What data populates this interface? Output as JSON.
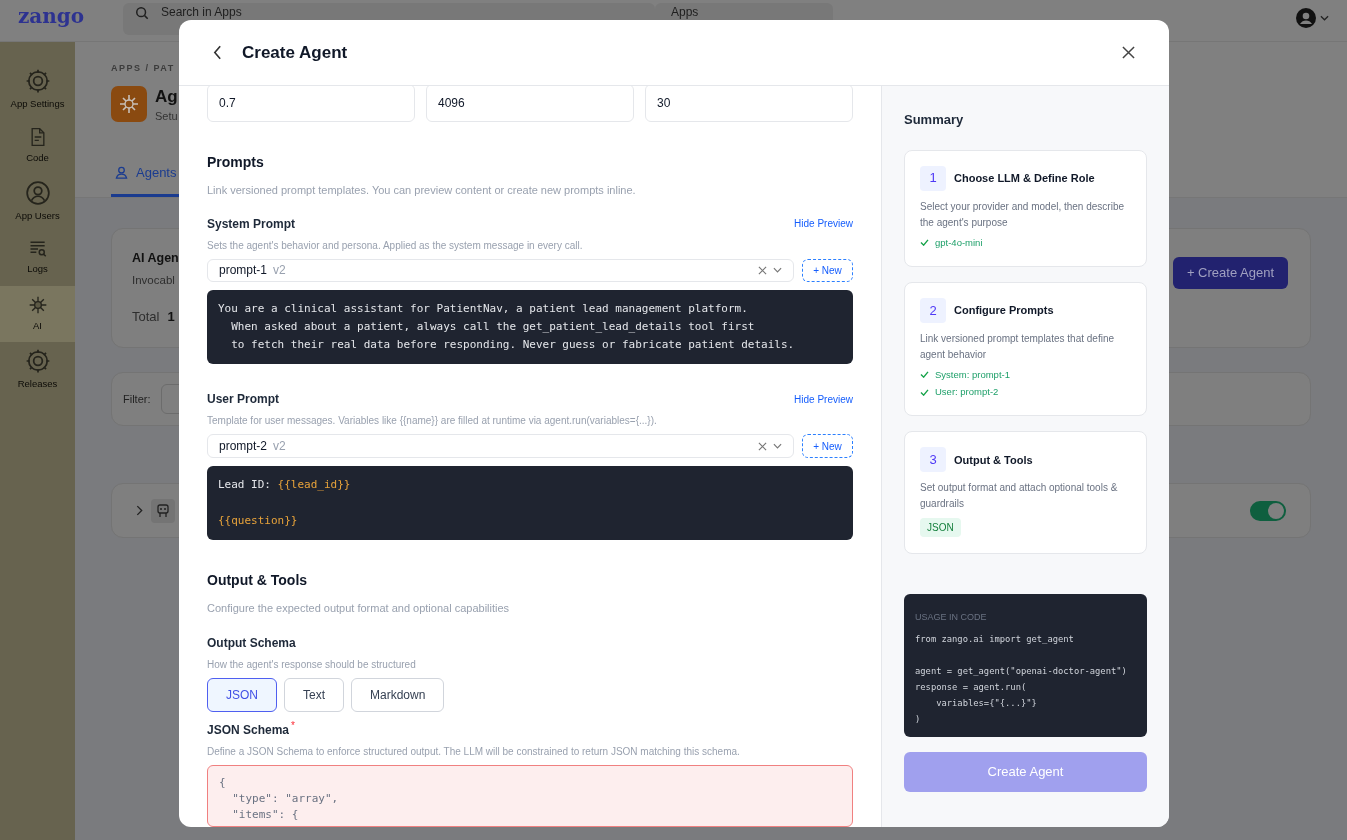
{
  "app": {
    "logo": "zango",
    "search": {
      "placeholder": "Search in Apps"
    },
    "app_select": "Apps"
  },
  "sidebar": [
    {
      "label": "App Settings",
      "selected": false
    },
    {
      "label": "Code",
      "selected": false
    },
    {
      "label": "App Users",
      "selected": false
    },
    {
      "label": "Logs",
      "selected": false
    },
    {
      "label": "AI",
      "selected": true
    },
    {
      "label": "Releases",
      "selected": false
    }
  ],
  "background": {
    "breadcrumb": "APPS / PAT",
    "title": "Ag",
    "subtitle": "Setu",
    "tab": {
      "label": "Agents",
      "selected": true
    },
    "card_title": "AI Agen",
    "card_subtitle": "Invocabl",
    "total_label": "Total",
    "total_value": "1",
    "create_button": "+ Create Agent",
    "filter_label": "Filter:",
    "agent_row": {
      "enabled": true
    }
  },
  "dialog": {
    "title": "Create Agent",
    "fields": [
      "0.7",
      "4096",
      "30"
    ],
    "prompts": {
      "heading": "Prompts",
      "description": "Link versioned prompt templates. You can preview content or create new prompts inline.",
      "items": [
        {
          "label": "System Prompt",
          "toggle": "Hide Preview",
          "description": "Sets the agent's behavior and persona. Applied as the system message in every call.",
          "value": "prompt-1",
          "version": "v2",
          "new_button": "+ New",
          "preview": [
            {
              "lines": [
                {
                  "segments": [
                    {
                      "kind": "plain",
                      "text": "You are a clinical assistant for PatientNav, a patient lead management platform."
                    }
                  ]
                },
                {
                  "segments": [
                    {
                      "kind": "plain",
                      "text": "  When asked about a patient, always call the get_patient_lead_details tool first"
                    }
                  ]
                },
                {
                  "segments": [
                    {
                      "kind": "plain",
                      "text": "  to fetch their real data before responding. Never guess or fabricate patient details."
                    }
                  ]
                }
              ]
            }
          ]
        },
        {
          "label": "User Prompt",
          "toggle": "Hide Preview",
          "description": "Template for user messages. Variables like {{name}} are filled at runtime via agent.run(variables={...}).",
          "value": "prompt-2",
          "version": "v2",
          "new_button": "+ New",
          "preview": [
            {
              "lines": [
                {
                  "segments": [
                    {
                      "kind": "plain",
                      "text": "Lead ID: "
                    },
                    {
                      "kind": "variable",
                      "text": "{{lead_id}}"
                    }
                  ]
                }
              ]
            },
            {
              "lines": [
                {
                  "segments": [
                    {
                      "kind": "variable",
                      "text": "{{question}}"
                    }
                  ]
                }
              ]
            }
          ]
        }
      ]
    },
    "output": {
      "heading": "Output & Tools",
      "description": "Configure the expected output format and optional capabilities",
      "schema_label": "Output Schema",
      "schema_description": "How the agent's response should be structured",
      "formats": [
        {
          "label": "JSON",
          "selected": true
        },
        {
          "label": "Text",
          "selected": false
        },
        {
          "label": "Markdown",
          "selected": false
        }
      ],
      "json_schema": {
        "label": "JSON Schema",
        "required_marker": "*",
        "description": "Define a JSON Schema to enforce structured output. The LLM will be constrained to return JSON matching this schema.",
        "invalid": true,
        "lines": [
          "{",
          "  \"type\": \"array\",",
          "  \"items\": {"
        ]
      }
    }
  },
  "summary": {
    "title": "Summary",
    "steps": [
      {
        "number": "1",
        "title": "Choose LLM & Define Role",
        "description": "Select your provider and model, then describe the agent's purpose",
        "checks": [
          "gpt-4o-mini"
        ]
      },
      {
        "number": "2",
        "title": "Configure Prompts",
        "description": "Link versioned prompt templates that define agent behavior",
        "checks": [
          "System: prompt-1",
          "User: prompt-2"
        ]
      },
      {
        "number": "3",
        "title": "Output & Tools",
        "description": "Set output format and attach optional tools & guardrails",
        "badge": "JSON"
      }
    ],
    "usage": {
      "label": "USAGE IN CODE",
      "blocks": [
        [
          "from zango.ai import get_agent"
        ],
        [
          "agent = get_agent(\"openai-doctor-agent\")",
          "response = agent.run(",
          "    variables={\"{...}\"}",
          ")"
        ]
      ]
    },
    "create_button": {
      "label": "Create Agent",
      "disabled": true
    }
  }
}
